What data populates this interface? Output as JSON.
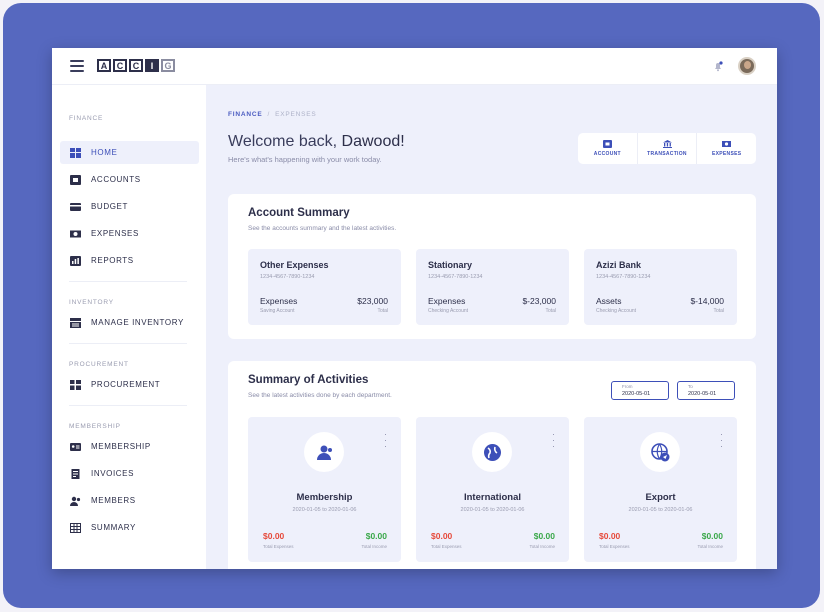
{
  "colors": {
    "accent": "#3d4fb8",
    "frame": "#5668bf",
    "negative": "#e64a3b",
    "positive": "#3aa84a"
  },
  "topbar": {
    "logo_letters": [
      "A",
      "C",
      "C",
      "I",
      "G"
    ],
    "bell_icon": "bell-icon",
    "avatar_icon": "avatar"
  },
  "sidebar": {
    "finance_label": "FINANCE",
    "items_finance": [
      {
        "label": "HOME",
        "icon": "grid-icon"
      },
      {
        "label": "ACCOUNTS",
        "icon": "wallet-icon"
      },
      {
        "label": "BUDGET",
        "icon": "card-icon"
      },
      {
        "label": "EXPENSES",
        "icon": "cash-icon"
      },
      {
        "label": "REPORTS",
        "icon": "chart-icon"
      }
    ],
    "inventory_label": "INVENTORY",
    "items_inventory": [
      {
        "label": "MANAGE INVENTORY",
        "icon": "warehouse-icon"
      }
    ],
    "procurement_label": "PROCUREMENT",
    "items_procurement": [
      {
        "label": "PROCUREMENT",
        "icon": "blocks-icon"
      }
    ],
    "membership_label": "MEMBERSHIP",
    "items_membership": [
      {
        "label": "MEMBERSHIP",
        "icon": "id-card-icon"
      },
      {
        "label": "INVOICES",
        "icon": "invoice-icon"
      },
      {
        "label": "MEMBERS",
        "icon": "members-icon"
      },
      {
        "label": "SUMMARY",
        "icon": "table-icon"
      }
    ]
  },
  "breadcrumb": {
    "root": "FINANCE",
    "separator": "/",
    "current": "EXPENSES"
  },
  "header": {
    "welcome_prefix": "Welcome back, ",
    "welcome_name": "Dawood!",
    "subtitle": "Here's what's happening with your work today."
  },
  "quick_actions": [
    {
      "label": "ACCOUNT",
      "icon": "wallet-icon"
    },
    {
      "label": "TRANSACTION",
      "icon": "bank-icon"
    },
    {
      "label": "EXPENSES",
      "icon": "cash-icon"
    }
  ],
  "account_summary": {
    "title": "Account Summary",
    "subtitle": "See the accounts summary and the latest activities.",
    "accounts": [
      {
        "name": "Other Expenses",
        "number": "1234-4567-7890-1234",
        "type_label": "Expenses",
        "account_type": "Saving Account",
        "amount": "$23,000",
        "total_label": "Total"
      },
      {
        "name": "Stationary",
        "number": "1234-4567-7890-1234",
        "type_label": "Expenses",
        "account_type": "Checking Account",
        "amount": "$-23,000",
        "total_label": "Total"
      },
      {
        "name": "Azizi Bank",
        "number": "1234-4567-7890-1234",
        "type_label": "Assets",
        "account_type": "Checking Account",
        "amount": "$-14,000",
        "total_label": "Total"
      }
    ]
  },
  "activities": {
    "title": "Summary of Activities",
    "subtitle": "See the latest activities done by each department.",
    "from": {
      "label": "From",
      "value": "2020-05-01"
    },
    "to": {
      "label": "To",
      "value": "2020-05-01"
    },
    "cards": [
      {
        "name": "Membership",
        "range": "2020-01-05 to 2020-01-06",
        "expenses": "$0.00",
        "expenses_label": "Total Expenses",
        "income": "$0.00",
        "income_label": "Total Income",
        "icon": "members-icon"
      },
      {
        "name": "International",
        "range": "2020-01-05 to 2020-01-06",
        "expenses": "$0.00",
        "expenses_label": "Total Expenses",
        "income": "$0.00",
        "income_label": "Total Income",
        "icon": "globe-icon"
      },
      {
        "name": "Export",
        "range": "2020-01-05 to 2020-01-06",
        "expenses": "$0.00",
        "expenses_label": "Total Expenses",
        "income": "$0.00",
        "income_label": "Total Income",
        "icon": "globe-send-icon"
      }
    ]
  }
}
